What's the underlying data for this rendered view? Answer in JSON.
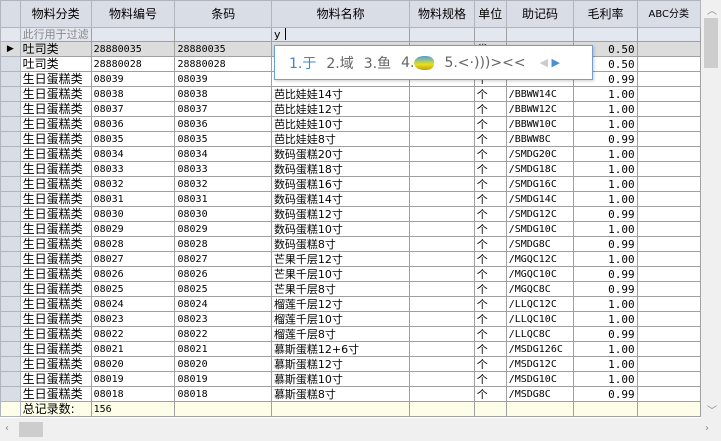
{
  "columns": [
    "物料分类",
    "物料编号",
    "条码",
    "物料名称",
    "物料规格",
    "单位",
    "助记码",
    "毛利率",
    "ABC分类"
  ],
  "filter": {
    "placeholder": "此行用于过滤",
    "name_value": "y"
  },
  "rows": [
    [
      "吐司类",
      "28880035",
      "28880035",
      "",
      "",
      "袋",
      "",
      "0.50",
      ""
    ],
    [
      "吐司类",
      "28880028",
      "28880028",
      "",
      "",
      "",
      "",
      "0.50",
      ""
    ],
    [
      "生日蛋糕类",
      "08039",
      "08039",
      "",
      "",
      "个",
      "",
      "0.99",
      ""
    ],
    [
      "生日蛋糕类",
      "08038",
      "08038",
      "芭比娃娃14寸",
      "",
      "个",
      "/BBWW14C",
      "1.00",
      ""
    ],
    [
      "生日蛋糕类",
      "08037",
      "08037",
      "芭比娃娃12寸",
      "",
      "个",
      "/BBWW12C",
      "1.00",
      ""
    ],
    [
      "生日蛋糕类",
      "08036",
      "08036",
      "芭比娃娃10寸",
      "",
      "个",
      "/BBWW10C",
      "1.00",
      ""
    ],
    [
      "生日蛋糕类",
      "08035",
      "08035",
      "芭比娃娃8寸",
      "",
      "个",
      "/BBWW8C",
      "0.99",
      ""
    ],
    [
      "生日蛋糕类",
      "08034",
      "08034",
      "数码蛋糕20寸",
      "",
      "个",
      "/SMDG20C",
      "1.00",
      ""
    ],
    [
      "生日蛋糕类",
      "08033",
      "08033",
      "数码蛋糕18寸",
      "",
      "个",
      "/SMDG18C",
      "1.00",
      ""
    ],
    [
      "生日蛋糕类",
      "08032",
      "08032",
      "数码蛋糕16寸",
      "",
      "个",
      "/SMDG16C",
      "1.00",
      ""
    ],
    [
      "生日蛋糕类",
      "08031",
      "08031",
      "数码蛋糕14寸",
      "",
      "个",
      "/SMDG14C",
      "1.00",
      ""
    ],
    [
      "生日蛋糕类",
      "08030",
      "08030",
      "数码蛋糕12寸",
      "",
      "个",
      "/SMDG12C",
      "0.99",
      ""
    ],
    [
      "生日蛋糕类",
      "08029",
      "08029",
      "数码蛋糕10寸",
      "",
      "个",
      "/SMDG10C",
      "1.00",
      ""
    ],
    [
      "生日蛋糕类",
      "08028",
      "08028",
      "数码蛋糕8寸",
      "",
      "个",
      "/SMDG8C",
      "0.99",
      ""
    ],
    [
      "生日蛋糕类",
      "08027",
      "08027",
      "芒果千层12寸",
      "",
      "个",
      "/MGQC12C",
      "1.00",
      ""
    ],
    [
      "生日蛋糕类",
      "08026",
      "08026",
      "芒果千层10寸",
      "",
      "个",
      "/MGQC10C",
      "0.99",
      ""
    ],
    [
      "生日蛋糕类",
      "08025",
      "08025",
      "芒果千层8寸",
      "",
      "个",
      "/MGQC8C",
      "0.99",
      ""
    ],
    [
      "生日蛋糕类",
      "08024",
      "08024",
      "榴莲千层12寸",
      "",
      "个",
      "/LLQC12C",
      "1.00",
      ""
    ],
    [
      "生日蛋糕类",
      "08023",
      "08023",
      "榴莲千层10寸",
      "",
      "个",
      "/LLQC10C",
      "1.00",
      ""
    ],
    [
      "生日蛋糕类",
      "08022",
      "08022",
      "榴莲千层8寸",
      "",
      "个",
      "/LLQC8C",
      "0.99",
      ""
    ],
    [
      "生日蛋糕类",
      "08021",
      "08021",
      "慕斯蛋糕12+6寸",
      "",
      "个",
      "/MSDG126C",
      "1.00",
      ""
    ],
    [
      "生日蛋糕类",
      "08020",
      "08020",
      "慕斯蛋糕12寸",
      "",
      "个",
      "/MSDG12C",
      "1.00",
      ""
    ],
    [
      "生日蛋糕类",
      "08019",
      "08019",
      "慕斯蛋糕10寸",
      "",
      "个",
      "/MSDG10C",
      "1.00",
      ""
    ],
    [
      "生日蛋糕类",
      "08018",
      "08018",
      "慕斯蛋糕8寸",
      "",
      "个",
      "/MSDG8C",
      "0.99",
      ""
    ]
  ],
  "footer": {
    "label": "总记录数:",
    "count": "156"
  },
  "ime": {
    "candidates": [
      "1.于",
      "2.域",
      "3.鱼",
      "4.",
      "5.<·)))><<"
    ],
    "fish_icon": "fish-emoji-icon"
  }
}
